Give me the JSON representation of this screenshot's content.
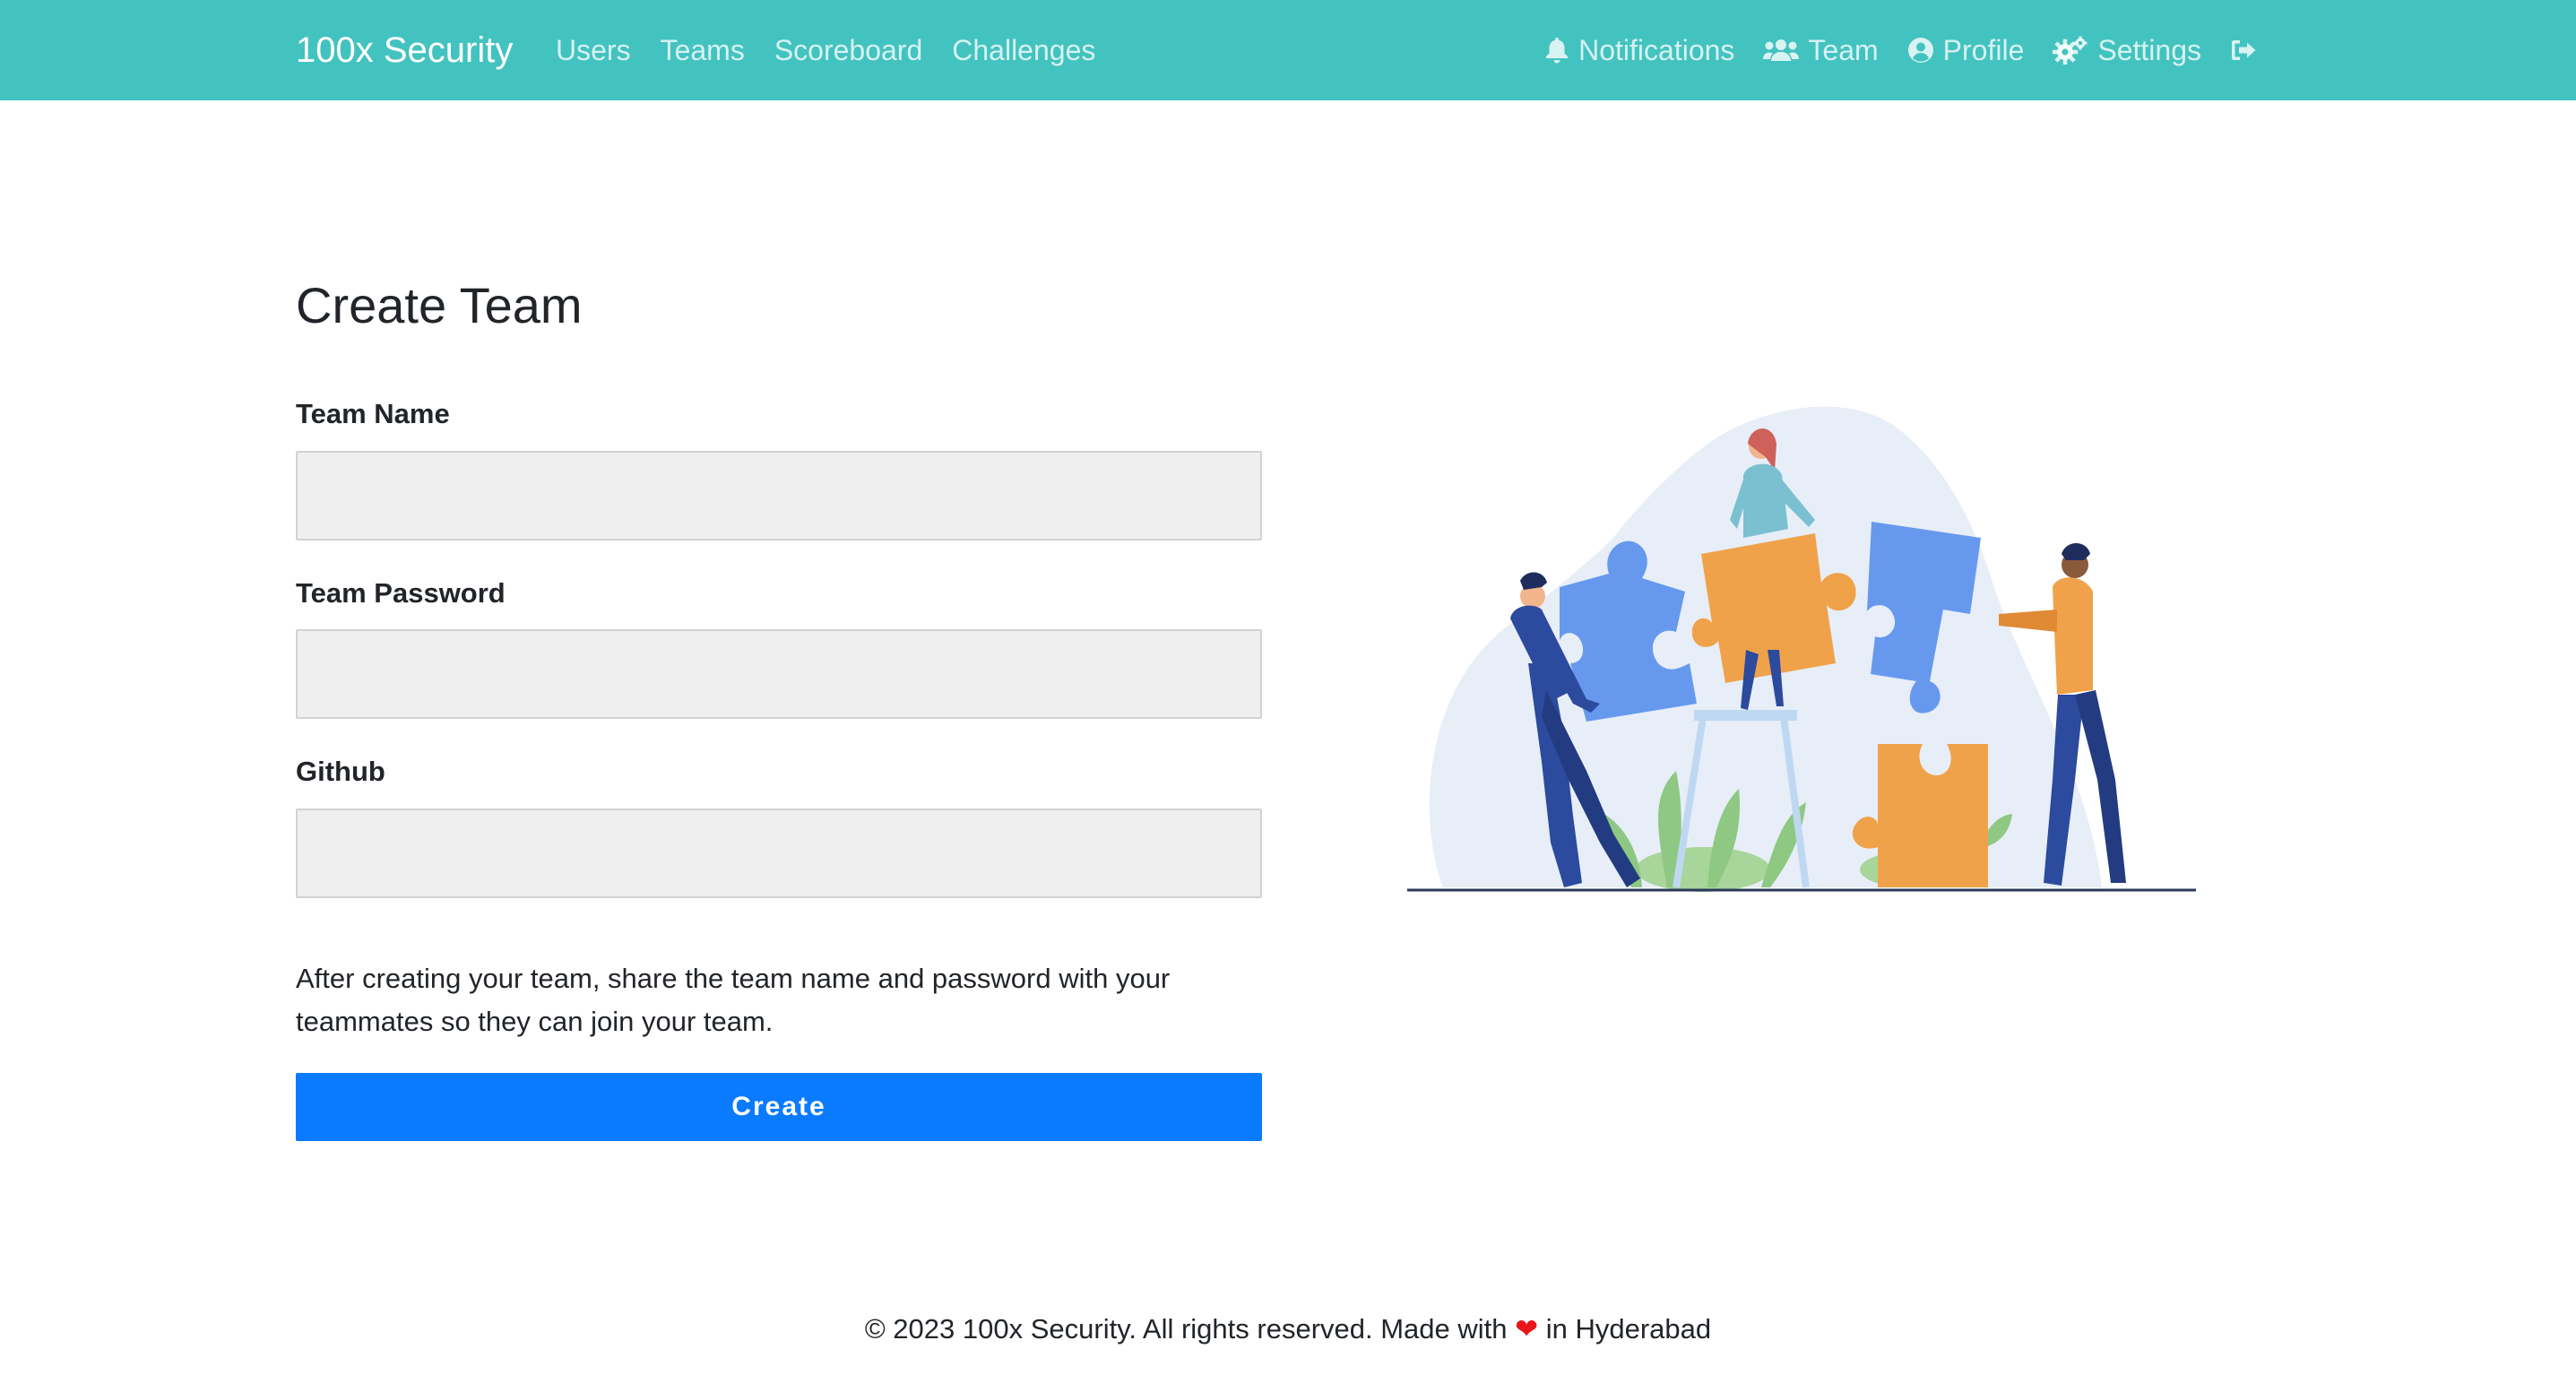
{
  "navbar": {
    "brand": "100x Security",
    "left_links": [
      "Users",
      "Teams",
      "Scoreboard",
      "Challenges"
    ],
    "right_links": {
      "notifications": "Notifications",
      "team": "Team",
      "profile": "Profile",
      "settings": "Settings"
    },
    "icons": [
      "bell-icon",
      "users-icon",
      "user-circle-icon",
      "cogs-icon",
      "sign-out-icon"
    ]
  },
  "main": {
    "title": "Create Team",
    "fields": {
      "team_name": {
        "label": "Team Name",
        "value": "",
        "placeholder": ""
      },
      "team_password": {
        "label": "Team Password",
        "value": "",
        "placeholder": ""
      },
      "github": {
        "label": "Github",
        "value": "",
        "placeholder": ""
      }
    },
    "info_text": "After creating your team, share the team name and password with your teammates so they can join your team.",
    "create_button": "Create"
  },
  "footer": {
    "before_heart": "© 2023 100x Security. All rights reserved. Made with",
    "heart": "❤",
    "after_heart": "in Hyderabad"
  },
  "colors": {
    "navbar": "#43c3c0",
    "button": "#0a7bff",
    "input_bg": "#efefef",
    "heart": "#e8151b",
    "puzzle_blue": "#6699ee",
    "puzzle_orange": "#f0a24a"
  }
}
